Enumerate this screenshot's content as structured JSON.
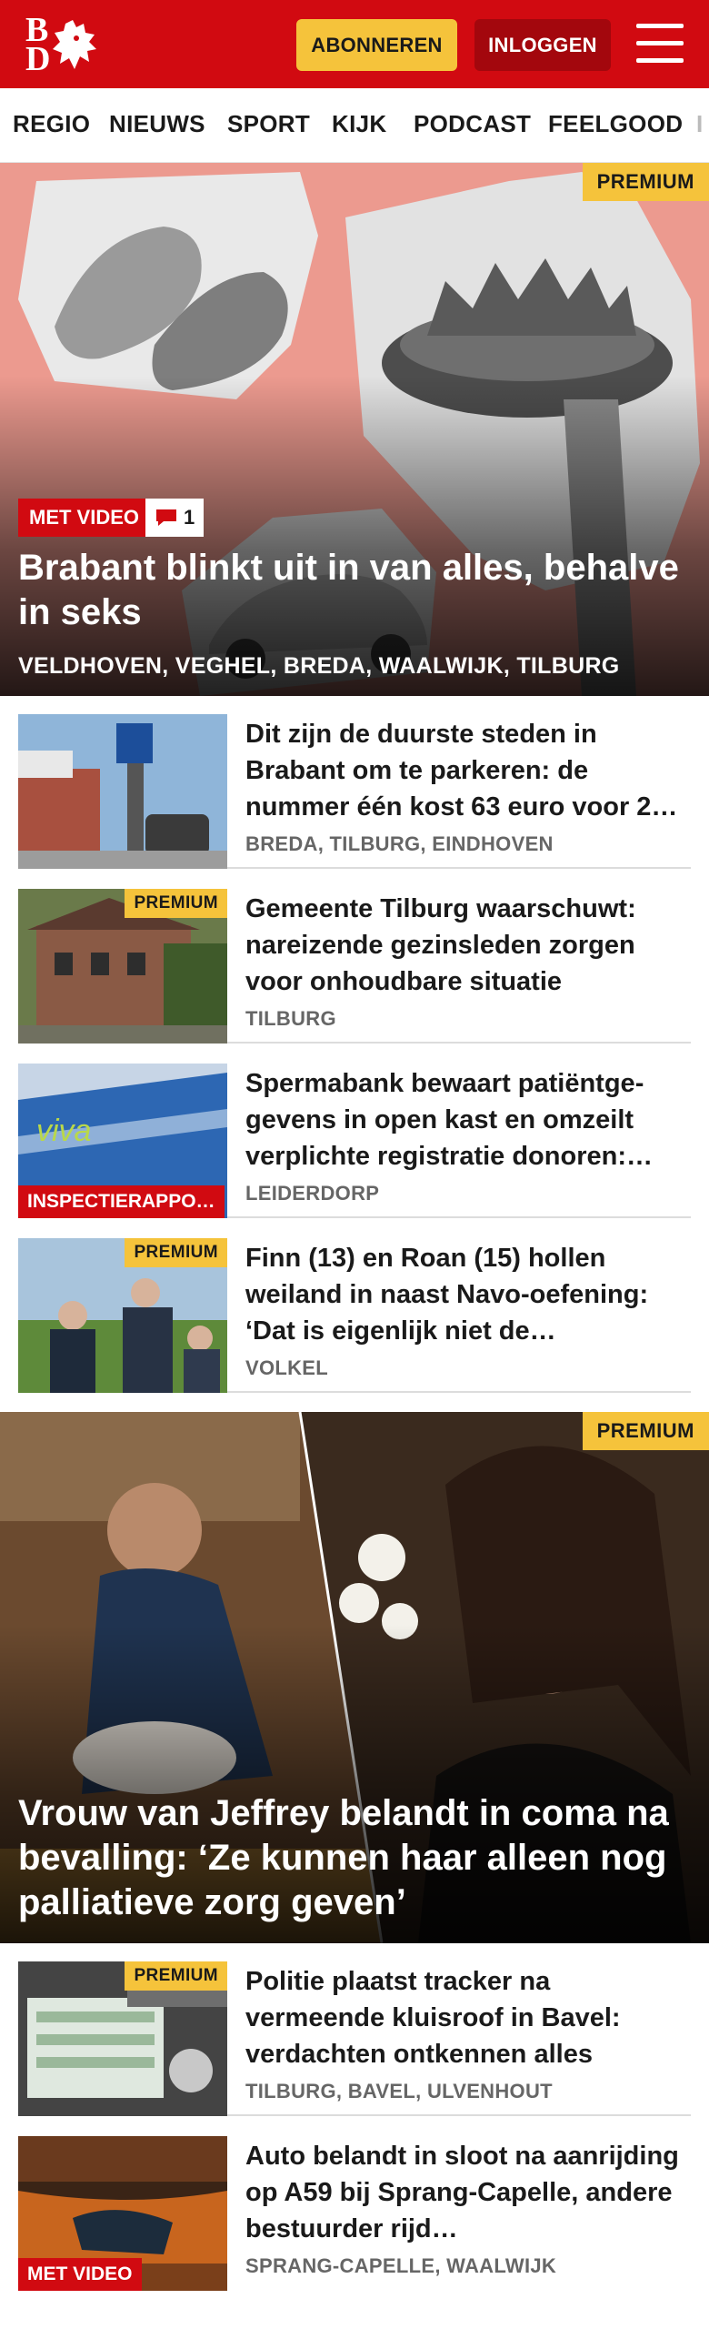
{
  "header": {
    "logo_top": "B",
    "logo_bottom": "D",
    "subscribe_label": "ABONNEREN",
    "login_label": "INLOGGEN",
    "brand_color": "#d10a11",
    "accent_color": "#f5c33b"
  },
  "nav": {
    "items": [
      "REGIO",
      "NIEUWS",
      "SPORT",
      "KIJK",
      "PODCAST",
      "FEELGOOD",
      "I"
    ]
  },
  "hero1": {
    "premium": "PREMIUM",
    "video_badge": "MET VIDEO",
    "comment_count": "1",
    "title": "Brabant blinkt uit in van alles, behalve in seks",
    "locations": "VELDHOVEN, VEGHEL, BREDA, WAALWIJK, TILBURG"
  },
  "articles": [
    {
      "title": "Dit zijn de duurste steden in Brabant om te parkeren: de nummer één kost 63 euro voor 2…",
      "locations": "BREDA, TILBURG, EINDHOVEN",
      "premium": "",
      "badge": ""
    },
    {
      "title": "Gemeente Tilburg waarschuwt: nareizende gezinsleden zorgen voor onhoudbare situatie",
      "locations": "TILBURG",
      "premium": "PREMIUM",
      "badge": ""
    },
    {
      "title": "Spermabank bewaart patiëntge­gevens in open kast en omzeilt verplichte registratie donoren:…",
      "locations": "LEIDERDORP",
      "premium": "",
      "badge": "INSPECTIERAPPO…"
    },
    {
      "title": "Finn (13) en Roan (15) hollen weiland in naast Navo-oefening: ‘Dat is eigenlijk niet de…",
      "locations": "VOLKEL",
      "premium": "PREMIUM",
      "badge": ""
    }
  ],
  "hero2": {
    "premium": "PREMIUM",
    "title": "Vrouw van Jeffrey belandt in coma na bevalling: ‘Ze kunnen haar alleen nog palliatieve zorg geven’"
  },
  "articles2": [
    {
      "title": "Politie plaatst tracker na vermeende kluisroof in Bavel: verdachten ontkennen alles",
      "locations": "TILBURG, BAVEL, ULVENHOUT",
      "premium": "PREMIUM",
      "badge": ""
    },
    {
      "title": "Auto belandt in sloot na aanrijding op A59 bij Sprang-Capelle, andere bestuurder rijd…",
      "locations": "SPRANG-CAPELLE, WAALWIJK",
      "premium": "",
      "badge": "MET VIDEO"
    }
  ]
}
